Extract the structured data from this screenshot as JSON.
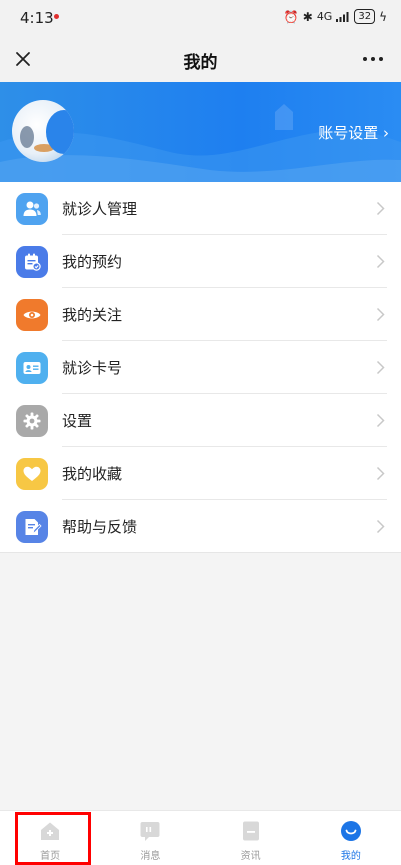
{
  "status_bar": {
    "time": "4:13",
    "network": "4G",
    "battery": "32"
  },
  "header": {
    "title": "我的"
  },
  "banner": {
    "account_settings": "账号设置"
  },
  "menu": {
    "items": [
      {
        "label": "就诊人管理",
        "icon": "patient-icon",
        "color": "#4fa3f0"
      },
      {
        "label": "我的预约",
        "icon": "appointment-icon",
        "color": "#4a7be8"
      },
      {
        "label": "我的关注",
        "icon": "eye-icon",
        "color": "#f07a2c"
      },
      {
        "label": "就诊卡号",
        "icon": "card-icon",
        "color": "#4fb0ef"
      },
      {
        "label": "设置",
        "icon": "gear-icon",
        "color": "#a9a9a9"
      },
      {
        "label": "我的收藏",
        "icon": "heart-icon",
        "color": "#f7c744"
      },
      {
        "label": "帮助与反馈",
        "icon": "feedback-icon",
        "color": "#5784e6"
      }
    ]
  },
  "tabs": [
    {
      "label": "首页",
      "icon": "home-icon",
      "active": false
    },
    {
      "label": "消息",
      "icon": "message-icon",
      "active": false
    },
    {
      "label": "资讯",
      "icon": "news-icon",
      "active": false
    },
    {
      "label": "我的",
      "icon": "profile-icon",
      "active": true
    }
  ],
  "colors": {
    "accent": "#1c75e6",
    "banner": "#2a8cf3",
    "highlight": "#ff0000"
  }
}
